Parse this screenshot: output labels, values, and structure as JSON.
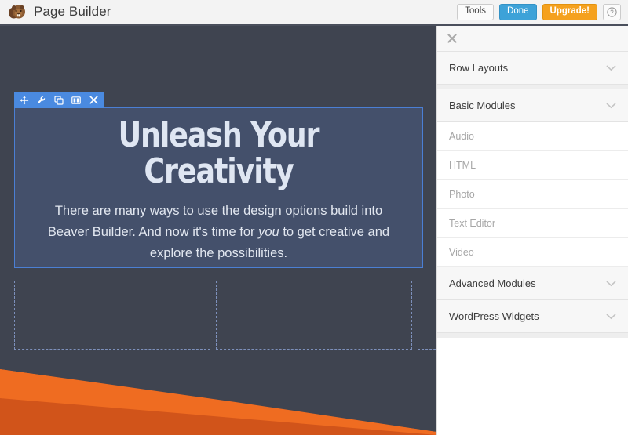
{
  "header": {
    "logo_icon": "beaver-logo",
    "title": "Page Builder",
    "buttons": {
      "tools": "Tools",
      "done": "Done",
      "upgrade": "Upgrade!",
      "help": "?"
    },
    "colors": {
      "done_bg": "#3da2d8",
      "upgrade_bg": "#f5a11e",
      "bar_bg": "#f3f3f3"
    }
  },
  "canvas": {
    "background": "#3f4450",
    "module": {
      "background": "#44506b",
      "outline": "#4b7fd4",
      "toolbar_bg": "#4a8ae0",
      "toolbar_icons": [
        "move-icon",
        "wrench-icon",
        "duplicate-icon",
        "columns-icon",
        "close-icon"
      ],
      "heading": "Unleash Your Creativity",
      "paragraph_part1": "There are many ways to use the design options build into Beaver Builder. And now it's time for ",
      "paragraph_emphasis": "you",
      "paragraph_part2": " to get creative and explore the possibilities."
    },
    "empty_columns": {
      "count": 3,
      "border_color": "#7d90bb"
    },
    "wave": {
      "light_orange": "#ef6c21",
      "dark_orange": "#d1541a"
    }
  },
  "sidebar": {
    "close_icon": "close-icon",
    "sections": [
      {
        "label": "Row Layouts",
        "icon": "chevron-down-icon"
      },
      {
        "label": "Basic Modules",
        "icon": "chevron-down-icon"
      }
    ],
    "modules": [
      {
        "label": "Audio"
      },
      {
        "label": "HTML"
      },
      {
        "label": "Photo"
      },
      {
        "label": "Text Editor"
      },
      {
        "label": "Video"
      }
    ],
    "sections_bottom": [
      {
        "label": "Advanced Modules",
        "icon": "chevron-down-icon"
      },
      {
        "label": "WordPress Widgets",
        "icon": "chevron-down-icon"
      }
    ]
  }
}
